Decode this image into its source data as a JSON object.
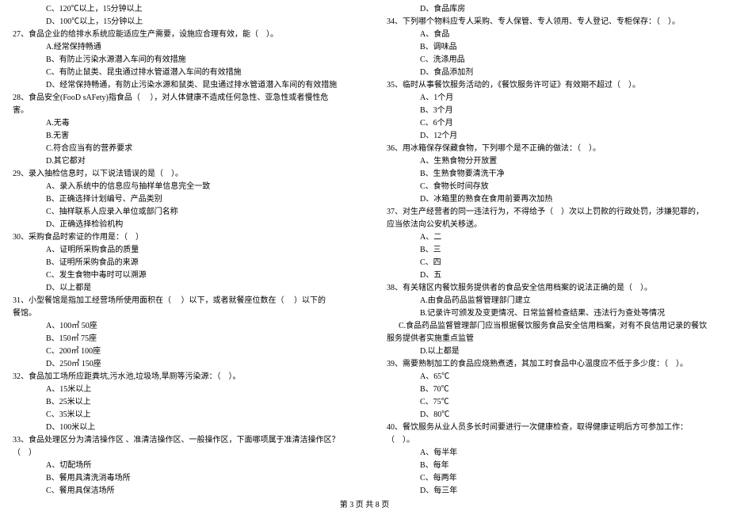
{
  "footer": "第 3 页  共 8 页",
  "left": [
    {
      "t": "opt",
      "v": "C、120℃以上，15分钟以上"
    },
    {
      "t": "opt",
      "v": "D、100℃以上，15分钟以上"
    },
    {
      "t": "q",
      "v": "27、食品企业的给排水系统应能适应生产需要，设施应合理有效，能（    ）。"
    },
    {
      "t": "opt",
      "v": "A.经常保持畅通"
    },
    {
      "t": "opt",
      "v": "B、有防止污染水源潜入车间的有效措施"
    },
    {
      "t": "opt",
      "v": "C、有防止鼠类、昆虫通过排水管道潜入车间的有效措施"
    },
    {
      "t": "opt",
      "v": "D、经常保持畅通，有防止污染水源和鼠类、昆虫通过排水管道潜入车间的有效措施"
    },
    {
      "t": "q",
      "v": "28、食品安全(FooD sAFety)指食品（     ），对人体健康不造成任何急性、亚急性或者慢性危"
    },
    {
      "t": "q",
      "v": "害。"
    },
    {
      "t": "opt",
      "v": "A.无毒"
    },
    {
      "t": "opt",
      "v": "B.无害"
    },
    {
      "t": "opt",
      "v": "C.符合应当有的营养要求"
    },
    {
      "t": "opt",
      "v": "D.其它都对"
    },
    {
      "t": "q",
      "v": "29、录入抽检信息时，以下说法错误的是（    ）。"
    },
    {
      "t": "opt",
      "v": "A、录入系统中的信息应与抽样单信息完全一致"
    },
    {
      "t": "opt",
      "v": "B、正确选择计划编号、产品类别"
    },
    {
      "t": "opt",
      "v": "C、抽样联系人应录入单位或部门名称"
    },
    {
      "t": "opt",
      "v": "D、正确选择检验机构"
    },
    {
      "t": "q",
      "v": "30、采购食品时索证的作用是：（    ）"
    },
    {
      "t": "opt",
      "v": "A、证明所采购食品的质量"
    },
    {
      "t": "opt",
      "v": "B、证明所采购食品的来源"
    },
    {
      "t": "opt",
      "v": "C、发生食物中毒时可以溯源"
    },
    {
      "t": "opt",
      "v": "D、以上都是"
    },
    {
      "t": "q",
      "v": "31、小型餐馆是指加工经营场所使用面积在（     ）以下，或者就餐座位数在（     ）以下的"
    },
    {
      "t": "q",
      "v": "餐馆。"
    },
    {
      "t": "opt",
      "v": "A、100㎡    50座"
    },
    {
      "t": "opt",
      "v": "B、150㎡    75座"
    },
    {
      "t": "opt",
      "v": "C、200㎡    100座"
    },
    {
      "t": "opt",
      "v": "D、250㎡    150座"
    },
    {
      "t": "q",
      "v": "32、食品加工场所应距粪坑,污水池,垃圾场,旱厕等污染源：（    ）。"
    },
    {
      "t": "opt",
      "v": "A、15米以上"
    },
    {
      "t": "opt",
      "v": "B、25米以上"
    },
    {
      "t": "opt",
      "v": "C、35米以上"
    },
    {
      "t": "opt",
      "v": "D、100米以上"
    },
    {
      "t": "q",
      "v": "33、食品处理区分为清洁操作区 、准清洁操作区、一般操作区，下面哪项属于准清洁操作区？"
    },
    {
      "t": "q",
      "v": "（    ）"
    },
    {
      "t": "opt",
      "v": "A、切配场所"
    },
    {
      "t": "opt",
      "v": "B、餐用具清洗消毒场所"
    },
    {
      "t": "opt",
      "v": "C、餐用具保洁场所"
    }
  ],
  "right": [
    {
      "t": "opt",
      "v": "D、食品库房"
    },
    {
      "t": "q",
      "v": "34、下列哪个物料应专人采购、专人保管、专人领用、专人登记、专柜保存：（    ）。"
    },
    {
      "t": "opt",
      "v": "A、食品"
    },
    {
      "t": "opt",
      "v": "B、调味品"
    },
    {
      "t": "opt",
      "v": "C、洗涤用品"
    },
    {
      "t": "opt",
      "v": "D、食品添加剂"
    },
    {
      "t": "q",
      "v": "35、临时从事餐饮服务活动的，《餐饮服务许可证》有效期不超过（    ）。"
    },
    {
      "t": "opt",
      "v": "A、1个月"
    },
    {
      "t": "opt",
      "v": "B、3个月"
    },
    {
      "t": "opt",
      "v": "C、6个月"
    },
    {
      "t": "opt",
      "v": "D、12个月"
    },
    {
      "t": "q",
      "v": "36、用冰箱保存保藏食物，下列哪个是不正确的做法：（    ）。"
    },
    {
      "t": "opt",
      "v": "A、生熟食物分开放置"
    },
    {
      "t": "opt",
      "v": "B、生熟食物要清洗干净"
    },
    {
      "t": "opt",
      "v": "C、食物长时间存放"
    },
    {
      "t": "opt",
      "v": "D、冰箱里的熟食在食用前要再次加热"
    },
    {
      "t": "q",
      "v": "37、对生产经营者的同一违法行为，不得给予（    ）次以上罚款的行政处罚，涉嫌犯罪的，"
    },
    {
      "t": "q",
      "v": "应当依法向公安机关移送。"
    },
    {
      "t": "opt",
      "v": "A、二"
    },
    {
      "t": "opt",
      "v": "B、三"
    },
    {
      "t": "opt",
      "v": "C、四"
    },
    {
      "t": "opt",
      "v": "D、五"
    },
    {
      "t": "q",
      "v": "38、有关辖区内餐饮服务提供者的食品安全信用档案的说法正确的是（    ）。"
    },
    {
      "t": "opt",
      "v": "A.由食品药品监督管理部门建立"
    },
    {
      "t": "opt",
      "v": "B.记录许可颁发及变更情况、日常监督检查结果、违法行为查处等情况"
    },
    {
      "t": "q",
      "v": "      C.食品药品监督管理部门应当根据餐饮服务食品安全信用档案，对有不良信用记录的餐饮"
    },
    {
      "t": "q",
      "v": "服务提供者实施重点监管"
    },
    {
      "t": "opt",
      "v": "D.以上都是"
    },
    {
      "t": "q",
      "v": "39、需要熟制加工的食品应烧熟煮透，其加工时食品中心温度应不低于多少度：（    ）。"
    },
    {
      "t": "opt",
      "v": "A、65℃"
    },
    {
      "t": "opt",
      "v": "B、70℃"
    },
    {
      "t": "opt",
      "v": "C、75℃"
    },
    {
      "t": "opt",
      "v": "D、80℃"
    },
    {
      "t": "q",
      "v": "40、餐饮服务从业人员多长时间要进行一次健康检查，取得健康证明后方可参加工作："
    },
    {
      "t": "q",
      "v": "（    ）。"
    },
    {
      "t": "opt",
      "v": "A、每半年"
    },
    {
      "t": "opt",
      "v": "B、每年"
    },
    {
      "t": "opt",
      "v": "C、每两年"
    },
    {
      "t": "opt",
      "v": "D、每三年"
    }
  ]
}
